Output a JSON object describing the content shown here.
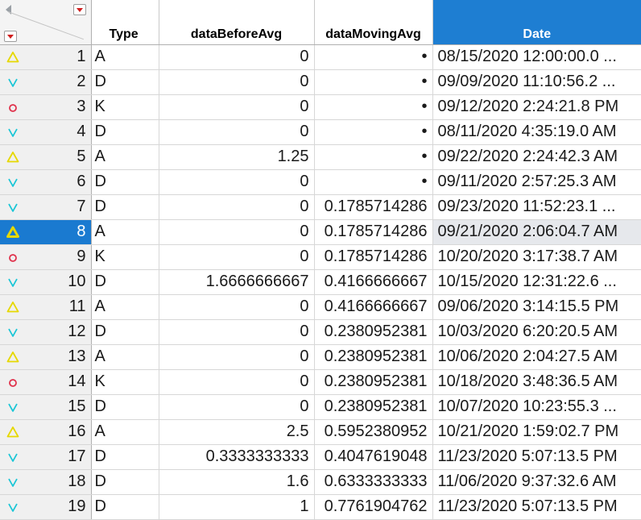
{
  "columns": {
    "type": "Type",
    "before": "dataBeforeAvg",
    "moving": "dataMovingAvg",
    "date": "Date"
  },
  "colors": {
    "selected": "#1a7ad0",
    "date_header": "#1e7ed2",
    "marker_triangle": "#e6d800",
    "marker_v": "#1ac6d6",
    "marker_circle": "#e0314b"
  },
  "rows": [
    {
      "n": "1",
      "type": "A",
      "before": "0",
      "moving": "•",
      "date": "08/15/2020 12:00:00.0 ...",
      "marker": "triangle-icon"
    },
    {
      "n": "2",
      "type": "D",
      "before": "0",
      "moving": "•",
      "date": "09/09/2020 11:10:56.2 ...",
      "marker": "v-icon"
    },
    {
      "n": "3",
      "type": "K",
      "before": "0",
      "moving": "•",
      "date": "09/12/2020 2:24:21.8 PM",
      "marker": "circle-icon"
    },
    {
      "n": "4",
      "type": "D",
      "before": "0",
      "moving": "•",
      "date": "08/11/2020 4:35:19.0 AM",
      "marker": "v-icon"
    },
    {
      "n": "5",
      "type": "A",
      "before": "1.25",
      "moving": "•",
      "date": "09/22/2020 2:24:42.3 AM",
      "marker": "triangle-icon"
    },
    {
      "n": "6",
      "type": "D",
      "before": "0",
      "moving": "•",
      "date": "09/11/2020 2:57:25.3 AM",
      "marker": "v-icon"
    },
    {
      "n": "7",
      "type": "D",
      "before": "0",
      "moving": "0.1785714286",
      "date": "09/23/2020 11:52:23.1 ...",
      "marker": "v-icon"
    },
    {
      "n": "8",
      "type": "A",
      "before": "0",
      "moving": "0.1785714286",
      "date": "09/21/2020 2:06:04.7 AM",
      "marker": "triangle-icon",
      "selected": true
    },
    {
      "n": "9",
      "type": "K",
      "before": "0",
      "moving": "0.1785714286",
      "date": "10/20/2020 3:17:38.7 AM",
      "marker": "circle-icon"
    },
    {
      "n": "10",
      "type": "D",
      "before": "1.6666666667",
      "moving": "0.4166666667",
      "date": "10/15/2020 12:31:22.6 ...",
      "marker": "v-icon"
    },
    {
      "n": "11",
      "type": "A",
      "before": "0",
      "moving": "0.4166666667",
      "date": "09/06/2020 3:14:15.5 PM",
      "marker": "triangle-icon"
    },
    {
      "n": "12",
      "type": "D",
      "before": "0",
      "moving": "0.2380952381",
      "date": "10/03/2020 6:20:20.5 AM",
      "marker": "v-icon"
    },
    {
      "n": "13",
      "type": "A",
      "before": "0",
      "moving": "0.2380952381",
      "date": "10/06/2020 2:04:27.5 AM",
      "marker": "triangle-icon"
    },
    {
      "n": "14",
      "type": "K",
      "before": "0",
      "moving": "0.2380952381",
      "date": "10/18/2020 3:48:36.5 AM",
      "marker": "circle-icon"
    },
    {
      "n": "15",
      "type": "D",
      "before": "0",
      "moving": "0.2380952381",
      "date": "10/07/2020 10:23:55.3 ...",
      "marker": "v-icon"
    },
    {
      "n": "16",
      "type": "A",
      "before": "2.5",
      "moving": "0.5952380952",
      "date": "10/21/2020 1:59:02.7 PM",
      "marker": "triangle-icon"
    },
    {
      "n": "17",
      "type": "D",
      "before": "0.3333333333",
      "moving": "0.4047619048",
      "date": "11/23/2020 5:07:13.5 PM",
      "marker": "v-icon"
    },
    {
      "n": "18",
      "type": "D",
      "before": "1.6",
      "moving": "0.6333333333",
      "date": "11/06/2020 9:37:32.6 AM",
      "marker": "v-icon"
    },
    {
      "n": "19",
      "type": "D",
      "before": "1",
      "moving": "0.7761904762",
      "date": "11/23/2020 5:07:13.5 PM",
      "marker": "v-icon"
    }
  ]
}
